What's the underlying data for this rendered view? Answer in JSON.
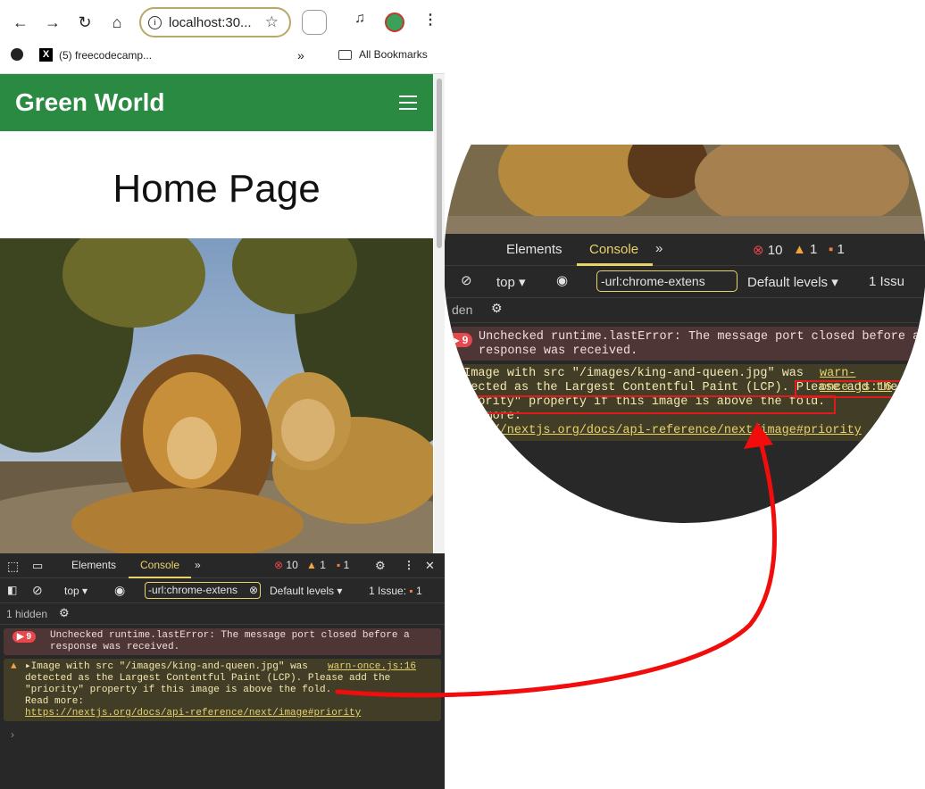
{
  "browser": {
    "url": "localhost:30...",
    "bookmarks": [
      {
        "label": "(5) freecodecamp..."
      },
      {
        "label": "All Bookmarks"
      }
    ],
    "overflow_label": "»"
  },
  "site": {
    "brand": "Green World",
    "heading": "Home Page",
    "colors": {
      "header": "#2a8a42"
    }
  },
  "devtools": {
    "tabs": [
      "Elements",
      "Console"
    ],
    "active_tab": "Console",
    "counts": {
      "errors": "10",
      "warnings": "1",
      "issues": "1"
    },
    "context": "top",
    "filter": "-url:chrome-extens",
    "levels": "Default levels",
    "issues_label": "1 Issue:",
    "issues_count": "1",
    "hidden": "1 hidden",
    "messages": [
      {
        "level": "error",
        "repeat": "9",
        "text_1": "Unchecked runtime.lastError: The message port closed before a",
        "text_2": "response was received."
      },
      {
        "level": "warning",
        "source": "warn-once.js:16",
        "line_1": "Image with src \"/images/king-and-queen.jpg\" was",
        "line_2": "detected as the Largest Contentful Paint (LCP). Please add the",
        "line_3": "\"priority\" property if this image is above the fold.",
        "line_4": "Read more:",
        "link": "https://nextjs.org/docs/api-reference/next/image#priority"
      }
    ]
  },
  "zoom": {
    "warn_l1": "Image with src \"/images/king-and-queen.jpg\" was",
    "warn_src": "warn-once.js:16",
    "warn_l2a": "detected as the Largest Contentful Paint (LCP). ",
    "warn_l2b": "Please add the",
    "warn_l3": "\"priority\" property if this image is above the fold.",
    "warn_l4": "Read more:",
    "warn_link": "https://nextjs.org/docs/api-reference/next/image#priority",
    "err_l1": "Unchecked runtime.lastError: The message port closed before a",
    "err_l2": "response was received.",
    "hidden_partial": "den",
    "issues_partial": "1 Issu"
  }
}
